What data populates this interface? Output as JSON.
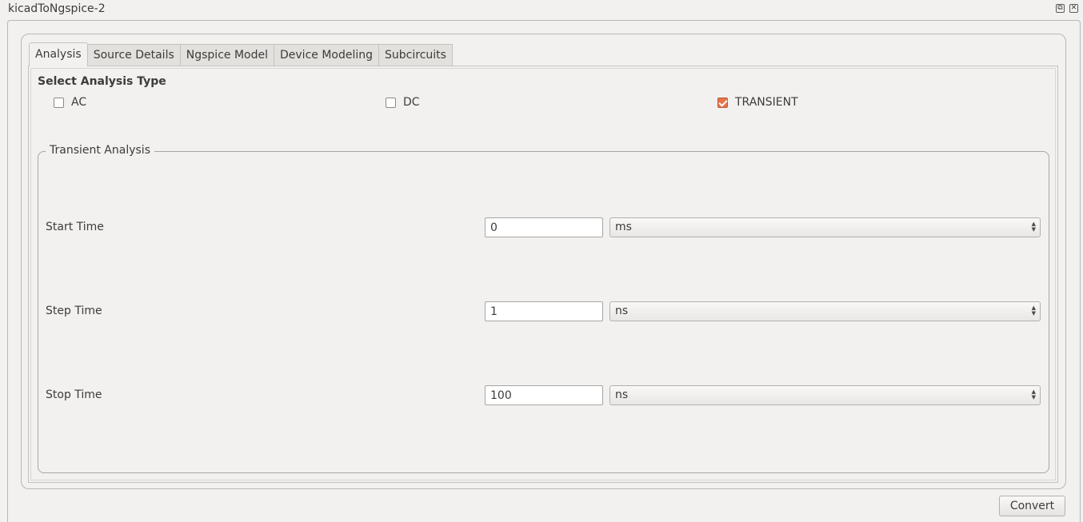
{
  "window": {
    "title": "kicadToNgspice-2"
  },
  "tabs": [
    {
      "label": "Analysis",
      "active": true
    },
    {
      "label": "Source Details",
      "active": false
    },
    {
      "label": "Ngspice Model",
      "active": false
    },
    {
      "label": "Device Modeling",
      "active": false
    },
    {
      "label": "Subcircuits",
      "active": false
    }
  ],
  "analysis": {
    "heading": "Select Analysis Type",
    "options": [
      {
        "label": "AC",
        "checked": false
      },
      {
        "label": "DC",
        "checked": false
      },
      {
        "label": "TRANSIENT",
        "checked": true
      }
    ]
  },
  "transient": {
    "legend": "Transient Analysis",
    "rows": [
      {
        "label": "Start Time",
        "value": "0",
        "unit": "ms"
      },
      {
        "label": "Step Time",
        "value": "1",
        "unit": "ns"
      },
      {
        "label": "Stop Time",
        "value": "100",
        "unit": "ns"
      }
    ]
  },
  "footer": {
    "convert_label": "Convert"
  },
  "colors": {
    "checkbox_accent": "#e8744a",
    "background": "#f2f1f0"
  }
}
